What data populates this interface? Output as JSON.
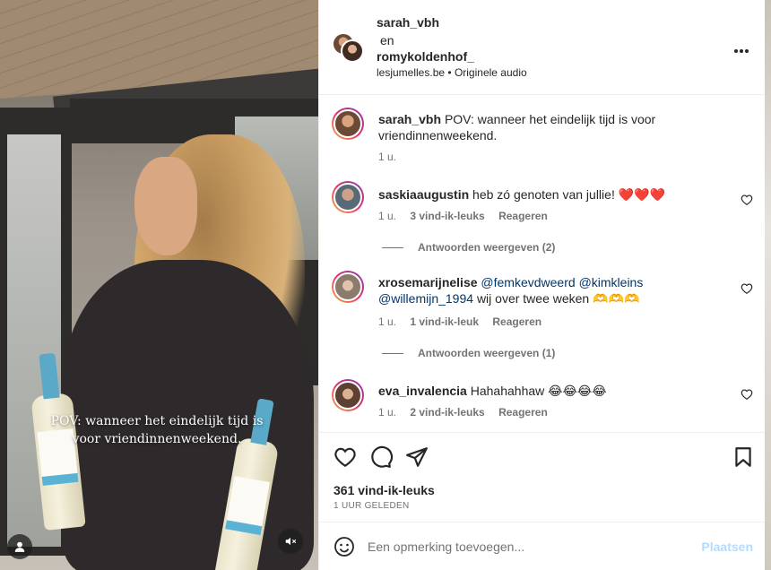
{
  "video": {
    "overlay_text": "POV: wanneer het eindelijk tijd is voor vriendinnenweekend.",
    "user_icon": "user-icon",
    "mute_icon": "speaker-muted-icon"
  },
  "header": {
    "user1": "sarah_vbh",
    "joiner": "en",
    "user2": "romykoldenhof_",
    "source": "lesjumelles.be",
    "separator": "•",
    "audio": "Originele audio",
    "more_icon": "more-icon"
  },
  "caption": {
    "username": "sarah_vbh",
    "text": "POV: wanneer het eindelijk tijd is voor vriendinnenweekend.",
    "time": "1 u."
  },
  "comments": [
    {
      "username": "saskiaaugustin",
      "text": "heb zó genoten van jullie! ❤️❤️❤️",
      "time": "1 u.",
      "likes": "3 vind-ik-leuks",
      "reply": "Reageren",
      "view_replies": "Antwoorden weergeven (2)"
    },
    {
      "username": "xrosemarijnelise",
      "mention1": "@femkevdweerd",
      "mention2": "@kimkleins",
      "mention3": "@willemijn_1994",
      "text": "wij over twee weken 🫶🫶🫶",
      "time": "1 u.",
      "likes": "1 vind-ik-leuk",
      "reply": "Reageren",
      "view_replies": "Antwoorden weergeven (1)"
    },
    {
      "username": "eva_invalencia",
      "text": "Hahahahhaw 😂😂😂😂",
      "time": "1 u.",
      "likes": "2 vind-ik-leuks",
      "reply": "Reageren"
    }
  ],
  "actions": {
    "likes": "361 vind-ik-leuks",
    "posted": "1 UUR GELEDEN"
  },
  "composer": {
    "placeholder": "Een opmerking toevoegen...",
    "post_label": "Plaatsen"
  },
  "colors": {
    "link": "#00376b",
    "muted": "#737373",
    "post_disabled": "#b3dbff"
  }
}
